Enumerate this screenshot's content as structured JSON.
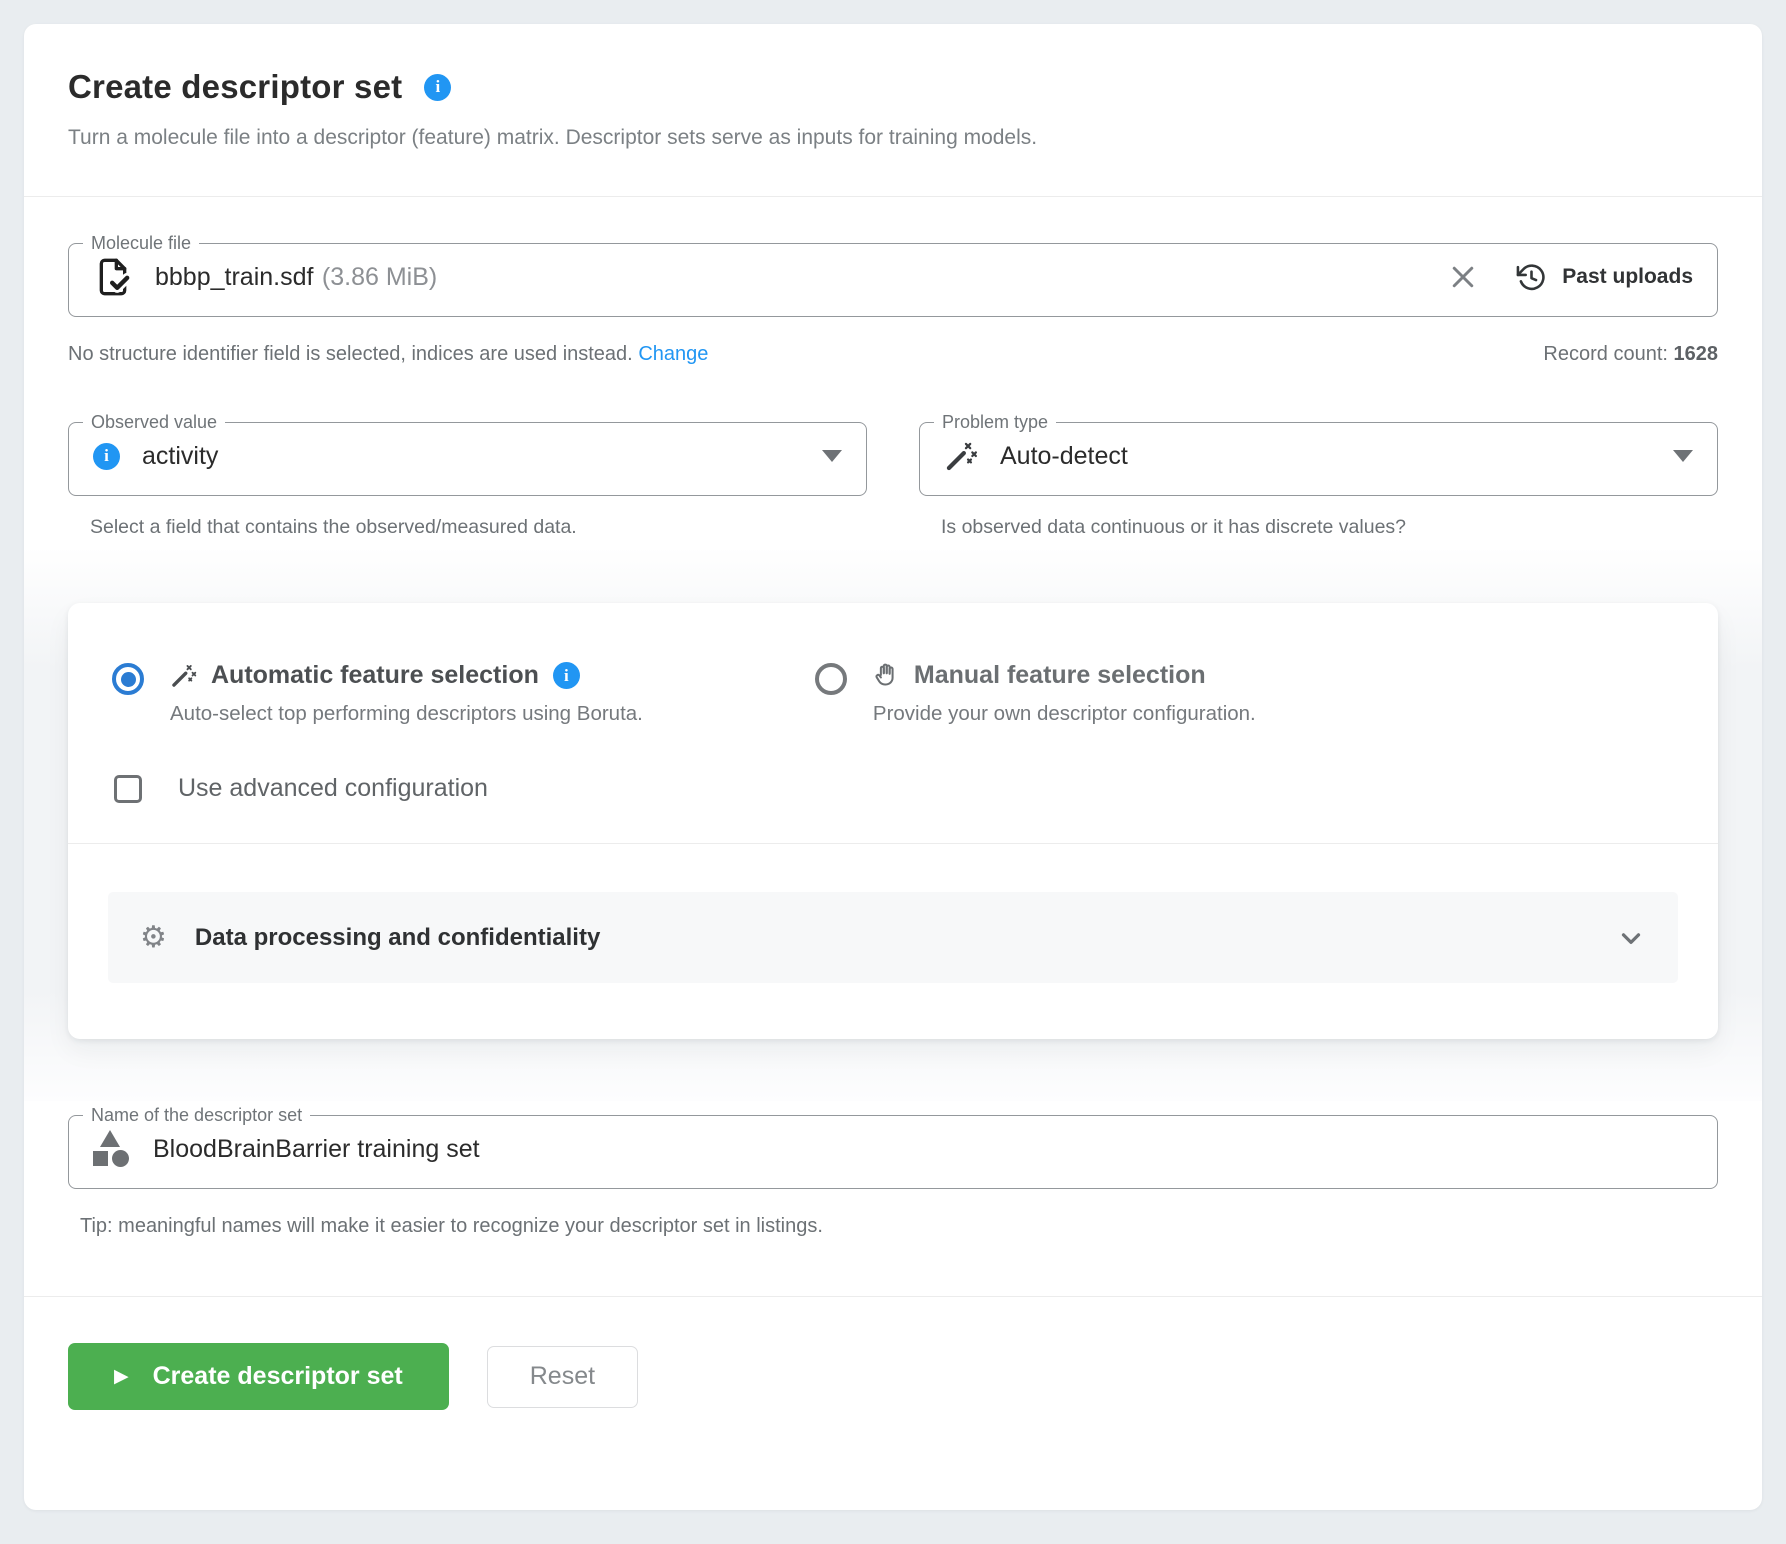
{
  "header": {
    "title": "Create descriptor set",
    "subtitle": "Turn a molecule file into a descriptor (feature) matrix. Descriptor sets serve as inputs for training models."
  },
  "molecule_file": {
    "label": "Molecule file",
    "file_name": "bbbp_train.sdf",
    "file_size": "(3.86 MiB)",
    "past_uploads_label": "Past uploads",
    "identifier_note": "No structure identifier field is selected, indices are used instead.",
    "change_link": "Change",
    "record_count_label": "Record count: ",
    "record_count_value": "1628"
  },
  "observed_value": {
    "label": "Observed value",
    "value": "activity",
    "helper": "Select a field that contains the observed/measured data."
  },
  "problem_type": {
    "label": "Problem type",
    "value": "Auto-detect",
    "helper": "Is observed data continuous or it has discrete values?"
  },
  "feature_selection": {
    "automatic": {
      "title": "Automatic feature selection",
      "description": "Auto-select top performing descriptors using Boruta.",
      "selected": true
    },
    "manual": {
      "title": "Manual feature selection",
      "description": "Provide your own descriptor configuration.",
      "selected": false
    },
    "advanced_checkbox_label": "Use advanced configuration",
    "accordion_label": "Data processing and confidentiality"
  },
  "descriptor_name": {
    "label": "Name of the descriptor set",
    "value": "BloodBrainBarrier training set",
    "tip": "Tip: meaningful names will make it easier to recognize your descriptor set in listings."
  },
  "actions": {
    "submit_label": "Create descriptor set",
    "reset_label": "Reset"
  },
  "icons": {
    "info_glyph": "i",
    "gear_glyph": "⚙",
    "play_glyph": "▶"
  },
  "colors": {
    "accent_blue": "#2196f3",
    "radio_blue": "#2b7cd3",
    "success_green": "#4caf50",
    "page_background": "#e9edf0"
  }
}
